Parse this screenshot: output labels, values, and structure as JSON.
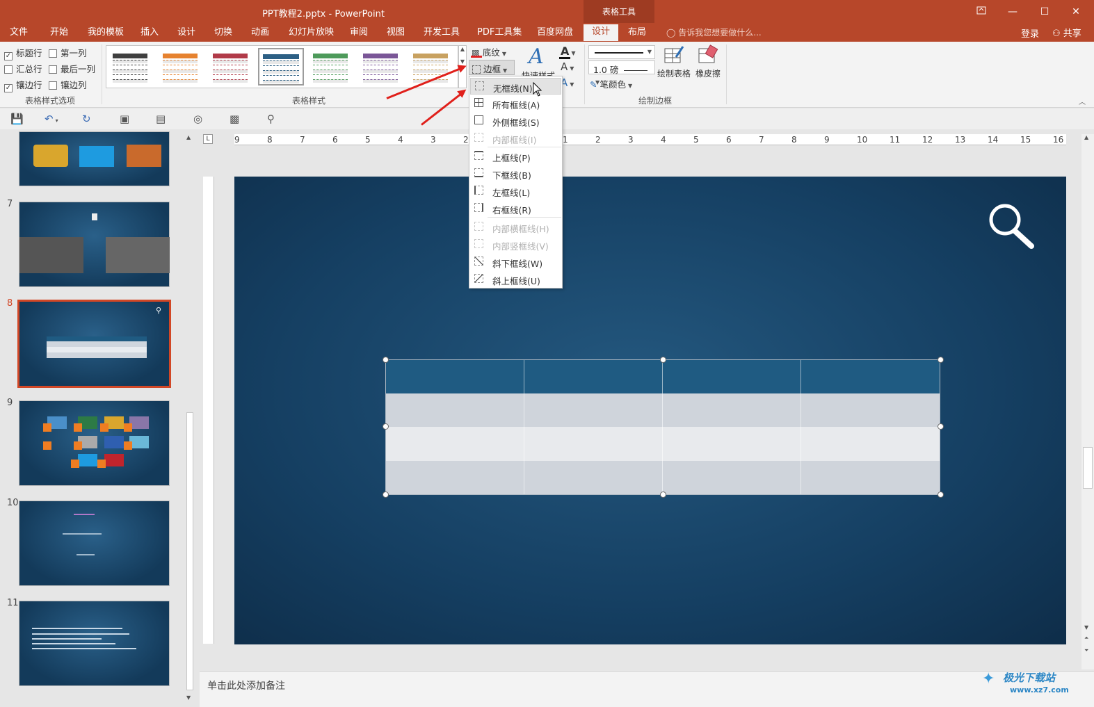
{
  "titlebar": {
    "doc_title": "PPT教程2.pptx - PowerPoint",
    "context_tab_group": "表格工具",
    "restore_icon": "ribbon-display-icon",
    "minimize": "—",
    "maximize": "☐",
    "close": "✕"
  },
  "tabs": [
    "文件",
    "开始",
    "我的模板",
    "插入",
    "设计",
    "切换",
    "动画",
    "幻灯片放映",
    "审阅",
    "视图",
    "开发工具",
    "PDF工具集",
    "百度网盘",
    "设计",
    "布局"
  ],
  "active_tab": "设计",
  "tell_me": "告诉我您想要做什么...",
  "login": "登录",
  "share": "共享",
  "ribbon": {
    "table_style_options": {
      "label": "表格样式选项",
      "checks": [
        {
          "label": "标题行",
          "checked": true
        },
        {
          "label": "第一列",
          "checked": false
        },
        {
          "label": "汇总行",
          "checked": false
        },
        {
          "label": "最后一列",
          "checked": false
        },
        {
          "label": "镶边行",
          "checked": true
        },
        {
          "label": "镶边列",
          "checked": false
        }
      ]
    },
    "table_styles": {
      "label": "表格样式",
      "shading": "底纹",
      "border": "边框",
      "swatch_colors": [
        "#3f3f3f",
        "#e6822f",
        "#b13a48",
        "#2c5f84",
        "#4d9a5a",
        "#7a5697",
        "#c8a160"
      ]
    },
    "wordart": {
      "quick_styles": "快速样式"
    },
    "draw_borders": {
      "label": "绘制边框",
      "pen_weight": "1.0 磅",
      "pen_color": "笔颜色",
      "draw_table": "绘制表格",
      "eraser": "橡皮擦"
    }
  },
  "border_menu": [
    {
      "label": "无框线(N)",
      "disabled": false,
      "highlight": true
    },
    {
      "label": "所有框线(A)",
      "disabled": false
    },
    {
      "label": "外侧框线(S)",
      "disabled": false
    },
    {
      "label": "内部框线(I)",
      "disabled": true
    },
    {
      "label": "上框线(P)",
      "disabled": false
    },
    {
      "label": "下框线(B)",
      "disabled": false
    },
    {
      "label": "左框线(L)",
      "disabled": false
    },
    {
      "label": "右框线(R)",
      "disabled": false
    },
    {
      "label": "内部横框线(H)",
      "disabled": true
    },
    {
      "label": "内部竖框线(V)",
      "disabled": true
    },
    {
      "label": "斜下框线(W)",
      "disabled": false
    },
    {
      "label": "斜上框线(U)",
      "disabled": false
    }
  ],
  "ruler": {
    "left_ticks": [
      "9",
      "8",
      "7",
      "6",
      "5",
      "4",
      "3",
      "2"
    ],
    "right_ticks": [
      "1",
      "2",
      "3",
      "4",
      "5",
      "6",
      "7",
      "8",
      "9",
      "10",
      "11",
      "12",
      "13",
      "14",
      "15",
      "16"
    ]
  },
  "slides": [
    {
      "number": "",
      "selected": false
    },
    {
      "number": "7",
      "selected": false
    },
    {
      "number": "8",
      "selected": true
    },
    {
      "number": "9",
      "selected": false
    },
    {
      "number": "10",
      "selected": false
    },
    {
      "number": "11",
      "selected": false
    }
  ],
  "notes_placeholder": "单击此处添加备注",
  "watermark": "极光下载站",
  "watermark_url": "www.xz7.com"
}
